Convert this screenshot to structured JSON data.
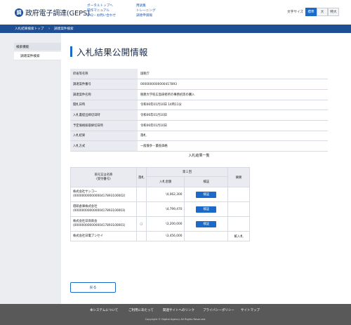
{
  "header": {
    "logo_mark": "調",
    "site_title": "政府電子調達(GEPS)",
    "links_col1": [
      "ポータルトップへ",
      "操作マニュアル",
      "FAQ・お問い合わせ"
    ],
    "links_col2": [
      "用語集",
      "トレーニング",
      "調達申請報"
    ],
    "font_size_label": "文字サイズ",
    "font_sizes": [
      "標準",
      "大",
      "特大"
    ],
    "active_font_size": "標準"
  },
  "breadcrumb": [
    "入札結果検索トップ",
    "調達案件検索"
  ],
  "sidebar": {
    "heading": "検索機能",
    "items": [
      "調達案件検索"
    ]
  },
  "page_title": "入札結果公開情報",
  "info_rows": [
    {
      "label": "府省等名称",
      "value": "国税庁"
    },
    {
      "label": "調達案件番号",
      "value": "0000000000000417893"
    },
    {
      "label": "調達案件名称",
      "value": "税務大学校広島研修所の事務机等の購入"
    },
    {
      "label": "開札日時",
      "value": "令和06年01月10日 14時11分"
    },
    {
      "label": "入札書提出締切日時",
      "value": "令和06年01月10日"
    },
    {
      "label": "予定価格採取締切日時",
      "value": "令和06年01月10日"
    },
    {
      "label": "入札結果",
      "value": "落札"
    },
    {
      "label": "入札方式",
      "value": "一般競争・最低価格"
    }
  ],
  "results": {
    "title": "入札結果一覧",
    "col_company": "商号又は名称\n(受付番号)",
    "col_award": "落札",
    "col_round": "第１回",
    "col_amount": "入札金額",
    "col_verify": "検証",
    "col_remarks": "摘要",
    "verify_label": "検証",
    "rows": [
      {
        "company": "株式会社サンコー",
        "number": "(00000000000000417893100002)",
        "award": "",
        "amount": "\\4,062,300",
        "verify": true,
        "remarks": ""
      },
      {
        "company": "壇研倉庫株式会社",
        "number": "(00000000000000417893100003)",
        "award": "",
        "amount": "\\4,799,470",
        "verify": true,
        "remarks": ""
      },
      {
        "company": "株式会社日商商会",
        "number": "(00000000000000417893100001)",
        "award": "○",
        "amount": "\\3,200,000",
        "verify": true,
        "remarks": ""
      },
      {
        "company": "株式会社日電ブンセイ",
        "number": "",
        "award": "",
        "amount": "\\3,456,000",
        "verify": false,
        "remarks": "紙入札"
      }
    ]
  },
  "back_label": "戻る",
  "footer": {
    "links": [
      "本システムについて",
      "ご利用にあたって",
      "関連サイトへのリンク",
      "プライバシーポリシー",
      "サイトマップ"
    ],
    "copyright": "Copyright © Digital Agency All Rights Reserved."
  }
}
